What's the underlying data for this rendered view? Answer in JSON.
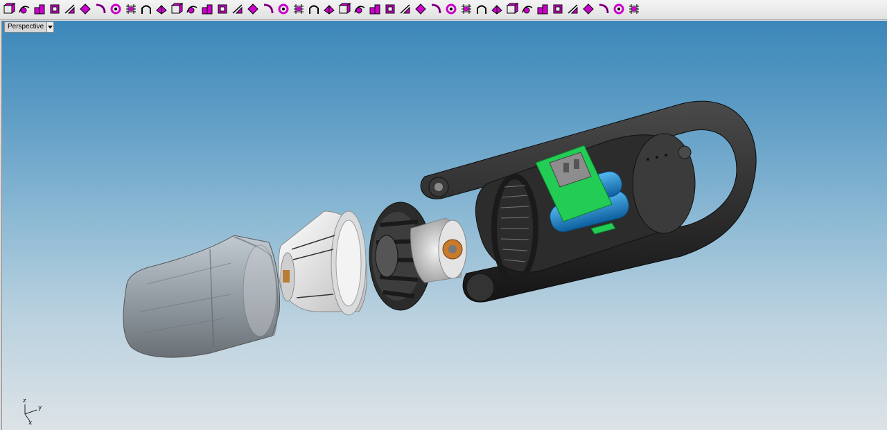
{
  "toolbar": {
    "buttons": [
      {
        "icon": "box-icon",
        "color": "#cc00cc"
      },
      {
        "icon": "sweep-icon",
        "color": "#cc00cc"
      },
      {
        "icon": "boolean-union-icon",
        "color": "#cc00cc"
      },
      {
        "icon": "box-edges-icon",
        "color": "#cc00cc"
      },
      {
        "icon": "fillet-edge-icon",
        "color": "#cc00cc"
      },
      {
        "icon": "chamfer-edge-icon",
        "color": "#cc00cc"
      },
      {
        "icon": "blend-edge-icon",
        "color": "#cc00cc"
      },
      {
        "icon": "rail-revolve-icon",
        "color": "#cc00cc"
      },
      {
        "icon": "network-surface-icon",
        "color": "#cc00cc"
      },
      {
        "icon": "pipe-arch-icon",
        "color": "#cc00cc"
      },
      {
        "icon": "extrude-curve-icon",
        "color": "#cc00cc"
      },
      {
        "icon": "offset-surface-icon",
        "color": "#cc00cc"
      },
      {
        "icon": "split-solid-icon",
        "color": "#cc00cc"
      },
      {
        "icon": "cap-planar-holes-icon",
        "color": "#cc00cc"
      },
      {
        "icon": "shell-icon",
        "color": "#cc00cc"
      },
      {
        "icon": "boolean-difference-icon",
        "color": "#cc00cc"
      },
      {
        "icon": "wire-cut-icon",
        "color": "#cc00cc"
      },
      {
        "icon": "boolean-split-icon",
        "color": "#cc00cc"
      },
      {
        "icon": "array-grid-icon",
        "color": "#cc00cc"
      },
      {
        "icon": "extract-surface-icon",
        "color": "#cc00cc"
      },
      {
        "icon": "delete-face-icon",
        "color": "#cc00cc"
      },
      {
        "icon": "move-face-icon",
        "color": "#cc00cc"
      },
      {
        "icon": "move-edge-icon",
        "color": "#cc00cc"
      },
      {
        "icon": "rotate-face-icon",
        "color": "#cc00cc"
      },
      {
        "icon": "twist-icon",
        "color": "#cc00cc"
      },
      {
        "icon": "patch-icon",
        "color": "#cc00cc"
      },
      {
        "icon": "control-points-icon",
        "color": "#cc00cc"
      },
      {
        "icon": "flow-along-curve-icon",
        "color": "#cc00cc"
      },
      {
        "icon": "project-curve-icon",
        "color": "#cc00cc"
      },
      {
        "icon": "split-curve-icon",
        "color": "#cc00cc"
      },
      {
        "icon": "branch-lines-icon",
        "color": "#cc00cc"
      },
      {
        "icon": "sketch-plane-icon",
        "color": "#cc00cc"
      },
      {
        "icon": "transform-handle-icon",
        "color": "#cc00cc"
      },
      {
        "icon": "rotate-star-icon",
        "color": "#cc00cc"
      },
      {
        "icon": "polyhedron-icon",
        "color": "#cc00cc"
      },
      {
        "icon": "rib-icon",
        "color": "#cc00cc"
      },
      {
        "icon": "flag-surface-icon",
        "color": "#cc00cc"
      },
      {
        "icon": "patch-surface-icon",
        "color": "#cc00cc"
      },
      {
        "icon": "planar-grid-icon",
        "color": "#cc00cc"
      },
      {
        "icon": "trim-cross-icon",
        "color": "#cc00cc"
      },
      {
        "icon": "solid-cube-icon",
        "color": "#cc00cc"
      },
      {
        "icon": "gear-settings-icon",
        "color": "#cc00cc"
      }
    ]
  },
  "viewport": {
    "name": "Perspective",
    "background_top": "#3b87b9",
    "background_bottom": "#dde3e7"
  },
  "axis": {
    "x": "x",
    "y": "y",
    "z": "z"
  },
  "model": {
    "parts": [
      "translucent-nozzle",
      "filter-cone",
      "fan-impeller",
      "motor",
      "main-housing",
      "pcb-board",
      "battery-pack",
      "handle-loop"
    ],
    "colors": {
      "pcb": "#22cc55",
      "battery": "#1e8fd6",
      "housing": "#2a2a2a",
      "nozzle": "#9aa0a5",
      "filter": "#e6e6e6",
      "motor_copper": "#c97a2a"
    }
  }
}
